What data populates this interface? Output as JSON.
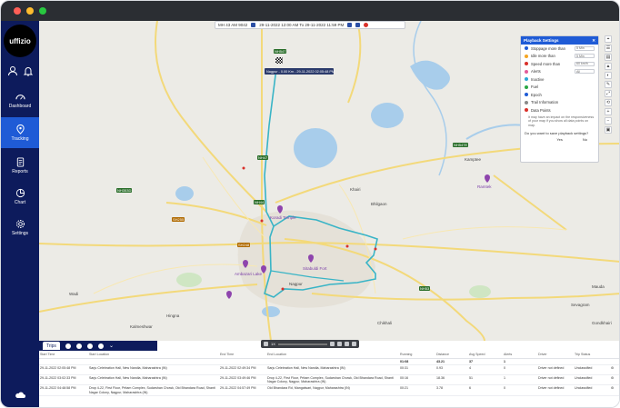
{
  "app": {
    "logo_text": "uffizio",
    "colors": {
      "sidebar": "#0d1b5c",
      "accent": "#1f5bd6",
      "route": "#39b4c6",
      "titlebar": "#2b2e33"
    }
  },
  "sidebar": {
    "items": [
      {
        "label": "Dashboard",
        "icon": "dashboard-icon"
      },
      {
        "label": "Tracking",
        "icon": "location-icon",
        "active": true
      },
      {
        "label": "Reports",
        "icon": "report-icon"
      },
      {
        "label": "Chart",
        "icon": "chart-icon"
      },
      {
        "label": "Settings",
        "icon": "gear-icon"
      }
    ]
  },
  "map_toolbar": {
    "vehicle": "MH 43 AM 9042",
    "range": "29-11-2022 12:00 AM To 29-11-2022 11:59 PM"
  },
  "route_tooltip": "Nagpur - 0.00 Km - 29-11-2022 02:05:48 PM",
  "map_labels": {
    "places": [
      "Kamptee",
      "Bhilgaon",
      "Khairi",
      "Wadi",
      "Nagpur",
      "Chikhali",
      "Kalmeshwar",
      "Hingna",
      "Gondkhairi",
      "Mauda",
      "Sevagram"
    ],
    "pois": [
      "Koradi Temple",
      "Ambazari Lake",
      "Sitabuldi Fort",
      "Ramtek"
    ],
    "highways": [
      "NH547",
      "NH47",
      "NH353D",
      "NH53",
      "SH255",
      "NH44",
      "NH547E",
      "SH248"
    ]
  },
  "playback_panel": {
    "title": "Playback Settings",
    "rows": [
      {
        "label": "Stoppage more than",
        "value": "5 Min",
        "color": "#1f5bd6"
      },
      {
        "label": "Idle more than",
        "value": "5 Min",
        "color": "#f5a623"
      },
      {
        "label": "Speed more than",
        "value": "60 km/h",
        "color": "#d9302a"
      },
      {
        "label": "Alerts",
        "value": "All",
        "color": "#e25c9a"
      },
      {
        "label": "Inactive",
        "value": "",
        "color": "#2aa7d6"
      },
      {
        "label": "Fuel",
        "value": "",
        "color": "#29a745"
      },
      {
        "label": "Epoch",
        "value": "",
        "color": "#1f5bd6"
      },
      {
        "label": "Trail Information",
        "value": "",
        "color": "#8a8a8a"
      },
      {
        "label": "Data Points",
        "value": "",
        "color": "#d9302a"
      }
    ],
    "note": "It may have an impact on the responsiveness of your map if you show all data points on map.",
    "question": "Do you want to save playback settings?",
    "yes": "Yes",
    "no": "No"
  },
  "map_tools": [
    "⌖",
    "☰",
    "▤",
    "▲",
    "◐",
    "✎",
    "⤢",
    "⟲",
    "+",
    "−",
    "▣"
  ],
  "player": {
    "speed": "1X"
  },
  "bottom": {
    "tab_label": "Trips",
    "columns": [
      "Start Time",
      "Start Location",
      "End Time",
      "End Location",
      "Running",
      "Distance",
      "Avg Speed",
      "Alerts",
      "Driver",
      "Trip Status"
    ],
    "totals": {
      "running": "01:08",
      "distance": "43.21",
      "avg_speed": "37",
      "alerts": "1"
    },
    "rows": [
      {
        "start_time": "29-11-2022 02:05:48 PM",
        "start_loc": "Sarju Celebration Hall, New Nandla, Maharashtra (IN)",
        "end_time": "29-11-2022 02:49:34 PM",
        "end_loc": "Sarju Celebration Hall, New Nandla, Maharashtra (IN)",
        "running": "00:31",
        "distance": "0.93",
        "avg": "4",
        "alerts": "0",
        "driver": "Driver not defined",
        "status": "Unclassified"
      },
      {
        "start_time": "29-11-2022 03:02:33 PM",
        "start_loc": "Sarju Celebration Hall, New Nandla, Maharashtra (IN)",
        "end_time": "29-11-2022 03:49:46 PM",
        "end_loc": "Drop 4-22, First Floor, Pritam Complex, Sudarshan Chowk, Old Bhandara Road, Shanti Nagar Colony, Nagpur, Maharashtra (IN)",
        "running": "00:16",
        "distance": "18.36",
        "avg": "51",
        "alerts": "1",
        "driver": "Driver not defined",
        "status": "Unclassified"
      },
      {
        "start_time": "29-11-2022 04:48:58 PM",
        "start_loc": "Drop 4-22, First Floor, Pritam Complex, Sudarshan Chowk, Old Bhandara Road, Shanti Nagar Colony, Nagpur, Maharashtra (IN)",
        "end_time": "29-11-2022 04:57:49 PM",
        "end_loc": "Old Bhandara Rd, Mangalwari, Nagpur, Maharashtra (IN)",
        "running": "00:21",
        "distance": "3.78",
        "avg": "6",
        "alerts": "0",
        "driver": "Driver not defined",
        "status": "Unclassified"
      }
    ]
  }
}
